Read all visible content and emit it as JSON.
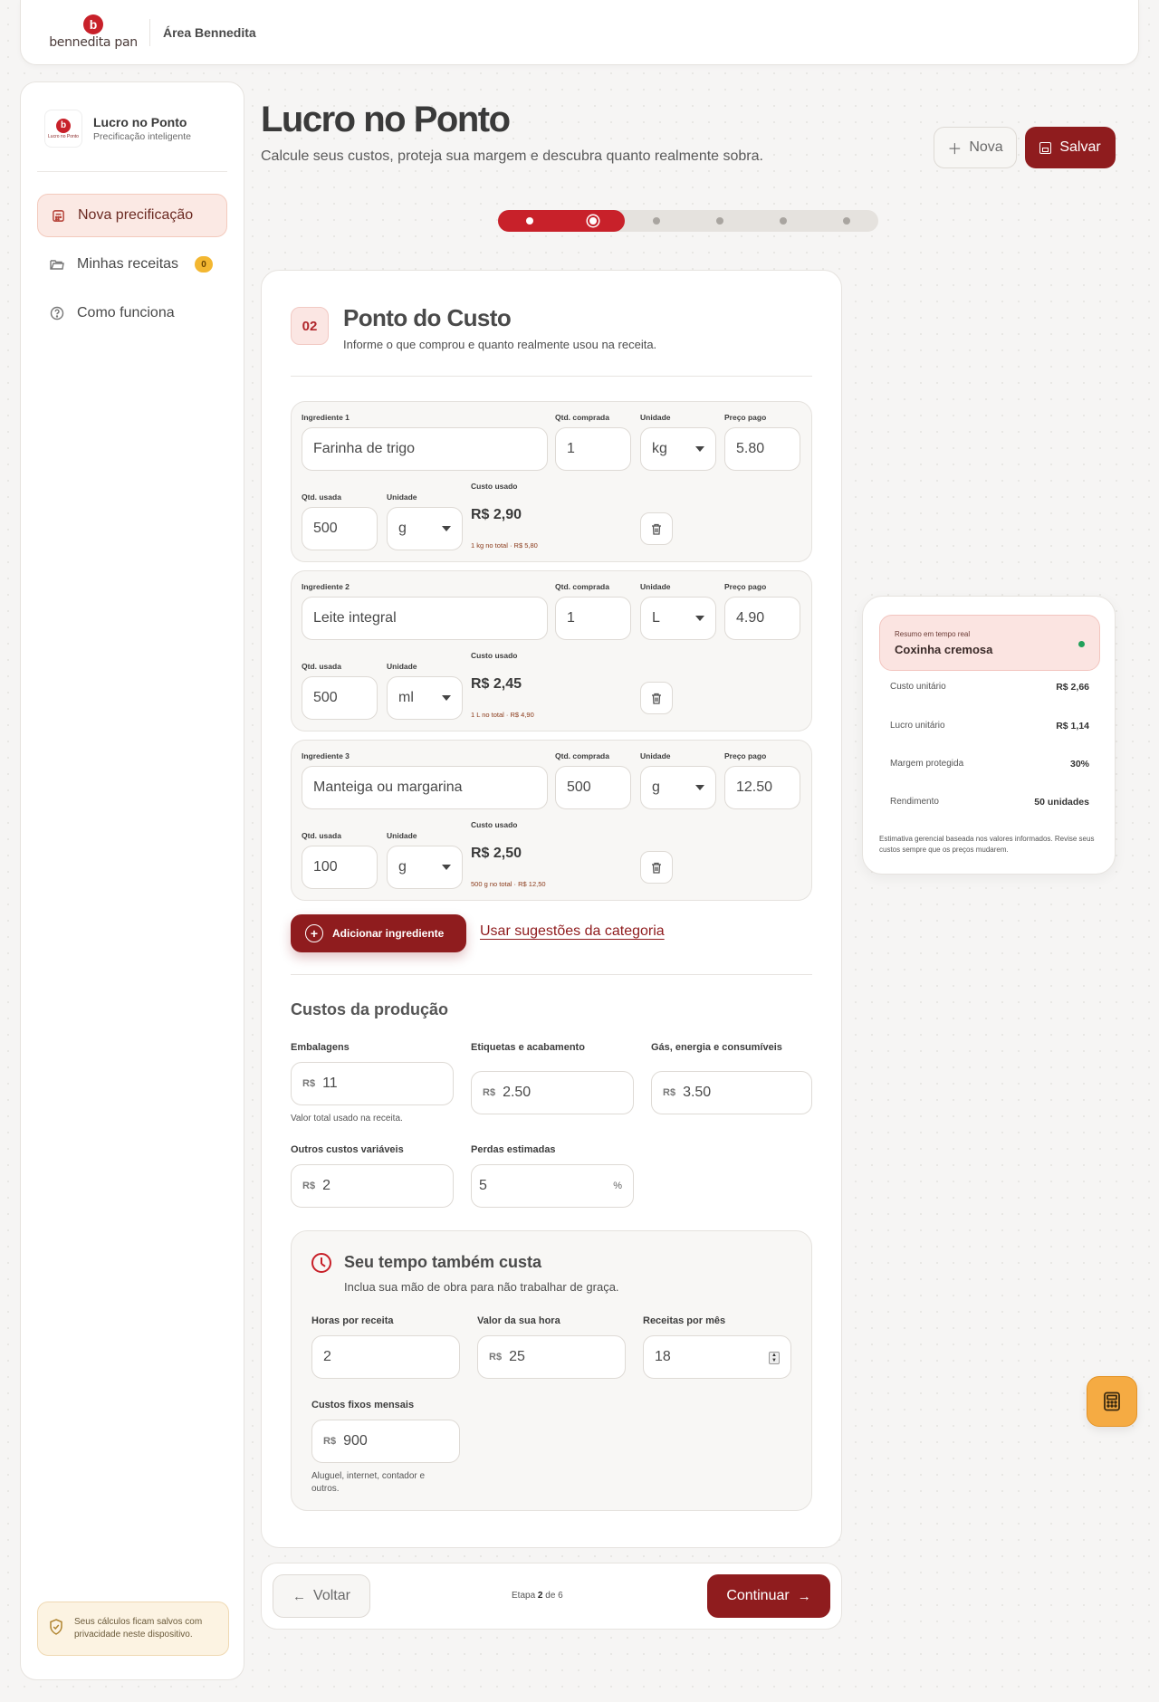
{
  "topbar": {
    "brand_letter": "b",
    "brand_name": "bennedita pan",
    "area": "Área Bennedita"
  },
  "sidebar": {
    "logo_text": "Lucro no Ponto",
    "title": "Lucro no Ponto",
    "subtitle": "Precificação inteligente",
    "items": [
      {
        "label": "Nova precificação",
        "icon": "calculator-icon",
        "active": true
      },
      {
        "label": "Minhas receitas",
        "icon": "folder-icon",
        "badge": "0"
      },
      {
        "label": "Como funciona",
        "icon": "help-circle-icon"
      }
    ],
    "privacy_note": "Seus cálculos ficam salvos com privacidade neste dispositivo."
  },
  "header": {
    "title": "Lucro no Ponto",
    "subtitle": "Calcule seus custos, proteja sua margem e descubra quanto realmente sobra.",
    "new_label": "Nova",
    "save_label": "Salvar"
  },
  "stepper": {
    "total": 6,
    "current": 2
  },
  "section": {
    "number": "02",
    "title": "Ponto do Custo",
    "subtitle": "Informe o que comprou e quanto realmente usou na receita."
  },
  "labels": {
    "qty_bought": "Qtd. comprada",
    "unit": "Unidade",
    "price_paid": "Preço pago",
    "qty_used": "Qtd. usada",
    "cost_used": "Custo usado"
  },
  "ingredients": [
    {
      "label": "Ingrediente 1",
      "name": "Farinha de trigo",
      "qty_bought": "1",
      "unit_bought": "kg",
      "price": "5.80",
      "qty_used": "500",
      "unit_used": "g",
      "cost": "R$ 2,90",
      "note": "1 kg no total · R$ 5,80"
    },
    {
      "label": "Ingrediente 2",
      "name": "Leite integral",
      "qty_bought": "1",
      "unit_bought": "L",
      "price": "4.90",
      "qty_used": "500",
      "unit_used": "ml",
      "cost": "R$ 2,45",
      "note": "1 L no total · R$ 4,90"
    },
    {
      "label": "Ingrediente 3",
      "name": "Manteiga ou margarina",
      "qty_bought": "500",
      "unit_bought": "g",
      "price": "12.50",
      "qty_used": "100",
      "unit_used": "g",
      "cost": "R$ 2,50",
      "note": "500 g no total · R$ 12,50"
    }
  ],
  "actions": {
    "add_ingredient": "Adicionar ingrediente",
    "use_suggestions": "Usar sugestões da categoria"
  },
  "production": {
    "title": "Custos da produção",
    "currency": "R$",
    "packaging_label": "Embalagens",
    "packaging_value": "11",
    "packaging_hint": "Valor total usado na receita.",
    "labels_label": "Etiquetas e acabamento",
    "labels_value": "2.50",
    "gas_label": "Gás, energia e consumíveis",
    "gas_value": "3.50",
    "other_label": "Outros custos variáveis",
    "other_value": "2",
    "loss_label": "Perdas estimadas",
    "loss_value": "5",
    "loss_unit": "%"
  },
  "time": {
    "title": "Seu tempo também custa",
    "subtitle": "Inclua sua mão de obra para não trabalhar de graça.",
    "hours_label": "Horas por receita",
    "hours_value": "2",
    "hour_value_label": "Valor da sua hora",
    "hour_value": "25",
    "recipes_label": "Receitas por mês",
    "recipes_value": "18",
    "fixed_label": "Custos fixos mensais",
    "fixed_value": "900",
    "fixed_hint": "Aluguel, internet, contador e outros."
  },
  "footer": {
    "back_label": "Voltar",
    "step_prefix": "Etapa",
    "step_current": "2",
    "step_sep": "de",
    "step_total": "6",
    "continue_label": "Continuar"
  },
  "summary": {
    "kicker": "Resumo em tempo real",
    "recipe": "Coxinha cremosa",
    "rows": [
      {
        "label": "Custo unitário",
        "value": "R$ 2,66"
      },
      {
        "label": "Lucro unitário",
        "value": "R$ 1,14"
      },
      {
        "label": "Margem protegida",
        "value": "30%"
      },
      {
        "label": "Rendimento",
        "value": "50 unidades"
      }
    ],
    "note": "Estimativa gerencial baseada nos valores informados. Revise seus custos sempre que os preços mudarem."
  },
  "colors": {
    "brand": "#c8212a",
    "primary_dark": "#8f1c1e",
    "accent_orange": "#f5ab43",
    "status_green": "#22a05a"
  }
}
